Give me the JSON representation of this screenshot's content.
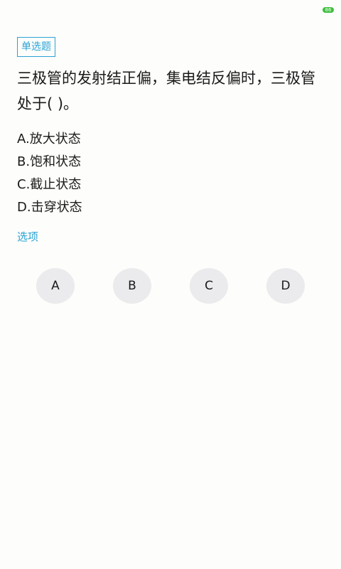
{
  "status_bar": {
    "battery_level": "86",
    "battery_color": "#3fbf3f"
  },
  "question": {
    "type_label": "单选题",
    "text": "三极管的发射结正偏，集电结反偏时，三极管处于( )。",
    "options": [
      "A.放大状态",
      "B.饱和状态",
      "C.截止状态",
      "D.击穿状态"
    ]
  },
  "answer_section": {
    "label": "选项",
    "buttons": [
      "A",
      "B",
      "C",
      "D"
    ]
  },
  "colors": {
    "accent": "#2ba3d6",
    "button_bg": "#ebebed",
    "background": "#fdfdfb"
  }
}
